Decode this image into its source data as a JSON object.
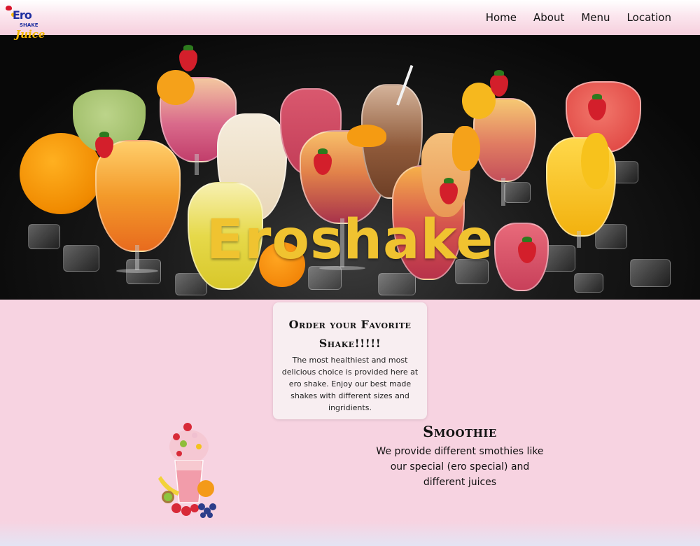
{
  "brand": {
    "logo_top": "Ero",
    "logo_middle": "SHAKE",
    "logo_bottom": "Juice"
  },
  "nav": {
    "items": [
      "Home",
      "About",
      "Menu",
      "Location"
    ]
  },
  "hero": {
    "title": "Eroshake"
  },
  "order_card": {
    "title": "Order your Favorite Shake!!!!!",
    "text": "The most healthiest and most delicious choice is provided here at ero shake. Enjoy our best made shakes with different sizes and ingridients."
  },
  "smoothie": {
    "title": "Smoothie",
    "text": "We provide different smothies like our special (ero special) and different juices"
  },
  "colors": {
    "accent": "#f0c330",
    "background": "#f7d3e1",
    "logo_blue": "#1e2fa0"
  }
}
